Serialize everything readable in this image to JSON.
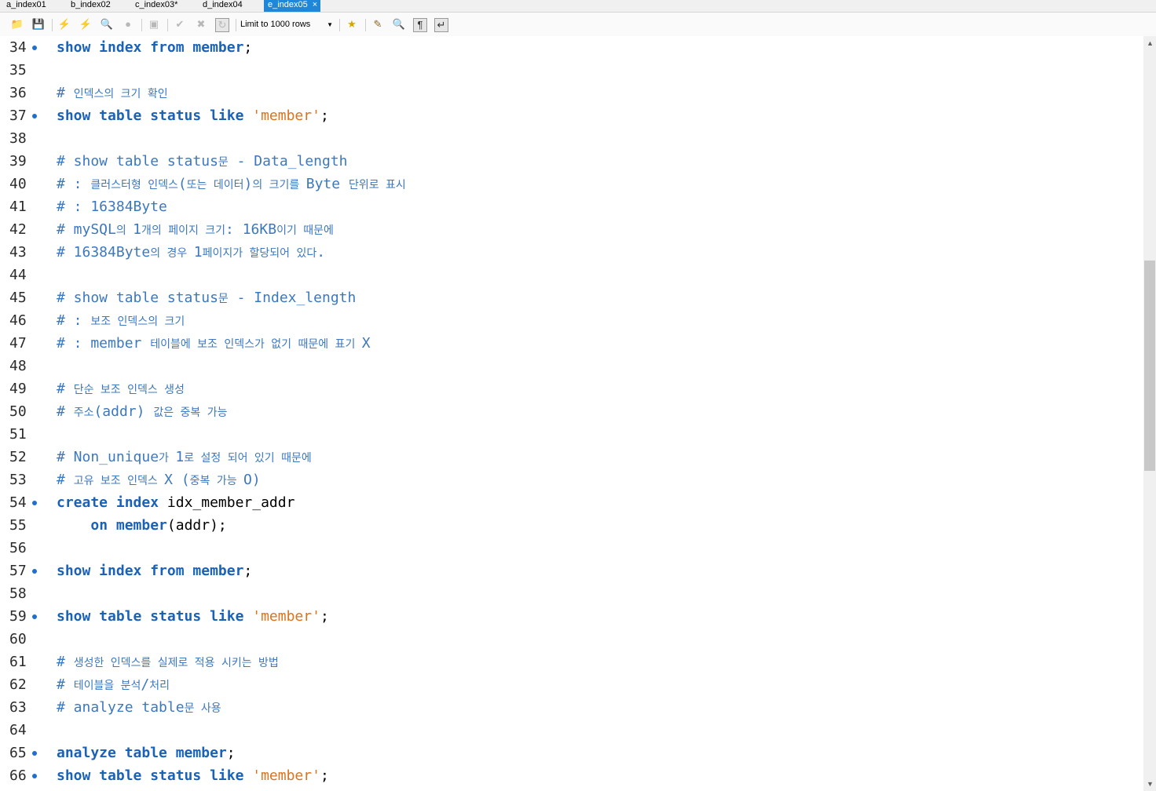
{
  "tabs": [
    {
      "label": "a_index01",
      "active": false
    },
    {
      "label": "b_index02",
      "active": false
    },
    {
      "label": "c_index03*",
      "active": false
    },
    {
      "label": "d_index04",
      "active": false
    },
    {
      "label": "e_index05",
      "active": true
    }
  ],
  "tab_close": "×",
  "toolbar": {
    "limit_label": "Limit to 1000 rows",
    "icons": [
      "open-folder-icon",
      "save-icon",
      "execute-icon",
      "execute-selection-icon",
      "explain-icon",
      "stop-icon",
      "toggle-results-icon",
      "commit-icon",
      "rollback-icon",
      "autocommit-icon",
      "add-snippet-icon",
      "beautify-icon",
      "find-icon",
      "invisible-chars-icon",
      "wrap-icon"
    ]
  },
  "editor": {
    "lines": [
      {
        "n": "34",
        "dot": true,
        "tokens": [
          [
            "kw",
            "show index from "
          ],
          [
            "kw",
            "member"
          ],
          [
            "id",
            ";"
          ]
        ]
      },
      {
        "n": "35",
        "dot": false,
        "tokens": []
      },
      {
        "n": "36",
        "dot": false,
        "tokens": [
          [
            "cm",
            "# "
          ],
          [
            "cmk",
            "인덱스의 크기 확인"
          ]
        ]
      },
      {
        "n": "37",
        "dot": true,
        "tokens": [
          [
            "kw",
            "show table status like "
          ],
          [
            "str",
            "'member'"
          ],
          [
            "id",
            ";"
          ]
        ]
      },
      {
        "n": "38",
        "dot": false,
        "tokens": []
      },
      {
        "n": "39",
        "dot": false,
        "tokens": [
          [
            "cm",
            "# show table status"
          ],
          [
            "cmk",
            "문"
          ],
          [
            "cm",
            " - Data_length"
          ]
        ]
      },
      {
        "n": "40",
        "dot": false,
        "tokens": [
          [
            "cm",
            "# : "
          ],
          [
            "cmk",
            "클러스터형 인덱스"
          ],
          [
            "cm",
            "("
          ],
          [
            "cmk",
            "또는 데이터"
          ],
          [
            "cm",
            ")"
          ],
          [
            "cmk",
            "의 크기를 "
          ],
          [
            "cm",
            "Byte "
          ],
          [
            "cmk",
            "단위로 표시"
          ]
        ]
      },
      {
        "n": "41",
        "dot": false,
        "tokens": [
          [
            "cm",
            "# : 16384Byte"
          ]
        ]
      },
      {
        "n": "42",
        "dot": false,
        "tokens": [
          [
            "cm",
            "# mySQL"
          ],
          [
            "cmk",
            "의 "
          ],
          [
            "cm",
            "1"
          ],
          [
            "cmk",
            "개의 페이지 크기"
          ],
          [
            "cm",
            ": 16KB"
          ],
          [
            "cmk",
            "이기 때문에"
          ]
        ]
      },
      {
        "n": "43",
        "dot": false,
        "tokens": [
          [
            "cm",
            "# 16384Byte"
          ],
          [
            "cmk",
            "의 경우 "
          ],
          [
            "cm",
            "1"
          ],
          [
            "cmk",
            "페이지가 할당되어 있다"
          ],
          [
            "cm",
            "."
          ]
        ]
      },
      {
        "n": "44",
        "dot": false,
        "tokens": []
      },
      {
        "n": "45",
        "dot": false,
        "tokens": [
          [
            "cm",
            "# show table status"
          ],
          [
            "cmk",
            "문"
          ],
          [
            "cm",
            " - Index_length"
          ]
        ]
      },
      {
        "n": "46",
        "dot": false,
        "tokens": [
          [
            "cm",
            "# : "
          ],
          [
            "cmk",
            "보조 인덱스의 크기"
          ]
        ]
      },
      {
        "n": "47",
        "dot": false,
        "tokens": [
          [
            "cm",
            "# : member "
          ],
          [
            "cmk",
            "테이블에 보조 인덱스가 없기 때문에 표기 "
          ],
          [
            "cm",
            "X"
          ]
        ]
      },
      {
        "n": "48",
        "dot": false,
        "tokens": []
      },
      {
        "n": "49",
        "dot": false,
        "tokens": [
          [
            "cm",
            "# "
          ],
          [
            "cmk",
            "단순 보조 인덱스 생성"
          ]
        ]
      },
      {
        "n": "50",
        "dot": false,
        "tokens": [
          [
            "cm",
            "# "
          ],
          [
            "cmk",
            "주소"
          ],
          [
            "cm",
            "(addr) "
          ],
          [
            "cmk",
            "값은 중복 가능"
          ]
        ]
      },
      {
        "n": "51",
        "dot": false,
        "tokens": []
      },
      {
        "n": "52",
        "dot": false,
        "tokens": [
          [
            "cm",
            "# Non_unique"
          ],
          [
            "cmk",
            "가 "
          ],
          [
            "cm",
            "1"
          ],
          [
            "cmk",
            "로 설정 되어 있기 때문에"
          ]
        ]
      },
      {
        "n": "53",
        "dot": false,
        "tokens": [
          [
            "cm",
            "# "
          ],
          [
            "cmk",
            "고유 보조 인덱스 "
          ],
          [
            "cm",
            "X ("
          ],
          [
            "cmk",
            "중복 가능 "
          ],
          [
            "cm",
            "O)"
          ]
        ]
      },
      {
        "n": "54",
        "dot": true,
        "tokens": [
          [
            "kw",
            "create index "
          ],
          [
            "id",
            "idx_member_addr"
          ]
        ]
      },
      {
        "n": "55",
        "dot": false,
        "tokens": [
          [
            "id",
            "    "
          ],
          [
            "kw",
            "on member"
          ],
          [
            "id",
            "(addr);"
          ]
        ]
      },
      {
        "n": "56",
        "dot": false,
        "tokens": []
      },
      {
        "n": "57",
        "dot": true,
        "tokens": [
          [
            "kw",
            "show index from member"
          ],
          [
            "id",
            ";"
          ]
        ]
      },
      {
        "n": "58",
        "dot": false,
        "tokens": []
      },
      {
        "n": "59",
        "dot": true,
        "tokens": [
          [
            "kw",
            "show table status like "
          ],
          [
            "str",
            "'member'"
          ],
          [
            "id",
            ";"
          ]
        ]
      },
      {
        "n": "60",
        "dot": false,
        "tokens": []
      },
      {
        "n": "61",
        "dot": false,
        "tokens": [
          [
            "cm",
            "# "
          ],
          [
            "cmk",
            "생성한 인덱스를 실제로 적용 시키는 방법"
          ]
        ]
      },
      {
        "n": "62",
        "dot": false,
        "tokens": [
          [
            "cm",
            "# "
          ],
          [
            "cmk",
            "테이블을 분석"
          ],
          [
            "cm",
            "/"
          ],
          [
            "cmk",
            "처리"
          ]
        ]
      },
      {
        "n": "63",
        "dot": false,
        "tokens": [
          [
            "cm",
            "# analyze table"
          ],
          [
            "cmk",
            "문 사용"
          ]
        ]
      },
      {
        "n": "64",
        "dot": false,
        "tokens": []
      },
      {
        "n": "65",
        "dot": true,
        "tokens": [
          [
            "kw",
            "analyze table member"
          ],
          [
            "id",
            ";"
          ]
        ]
      },
      {
        "n": "66",
        "dot": true,
        "tokens": [
          [
            "kw",
            "show table status like "
          ],
          [
            "str",
            "'member'"
          ],
          [
            "id",
            ";"
          ]
        ]
      }
    ]
  },
  "colors": {
    "keyword": "#1a61b8",
    "string": "#d9741e",
    "comment": "#3b78c0",
    "active_tab": "#1f86d8"
  }
}
